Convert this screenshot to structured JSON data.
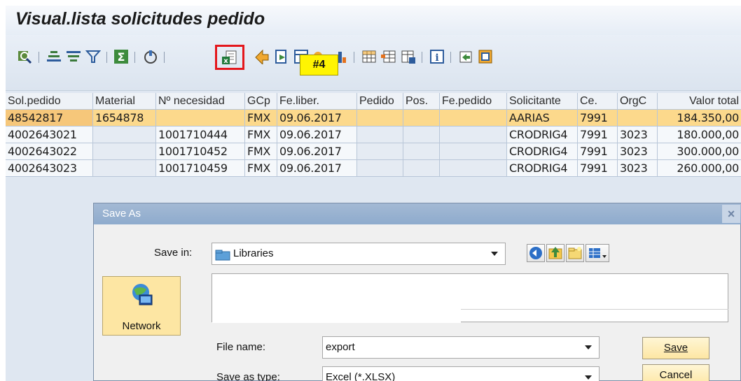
{
  "window": {
    "title": "Visual.lista solicitudes pedido"
  },
  "tooltip": {
    "text": "#4"
  },
  "toolbar": {
    "icons": [
      "details-icon",
      "sort-ascending-icon",
      "sort-descending-icon",
      "filter-icon",
      "sum-icon",
      "subtotal-icon",
      "export-spreadsheet-icon",
      "print-preview-icon",
      "local-file-icon",
      "change-layout-icon",
      "abc-analysis-icon",
      "graphic-icon",
      "grid-layout-icon",
      "select-layout-icon",
      "save-layout-icon",
      "info-icon",
      "mail-icon",
      "settings-icon"
    ]
  },
  "table": {
    "columns": [
      "Sol.pedido",
      "Material",
      "Nº necesidad",
      "GCp",
      "Fe.liber.",
      "Pedido",
      "Pos.",
      "Fe.pedido",
      "Solicitante",
      "Ce.",
      "OrgC",
      "Valor total"
    ],
    "rows": [
      [
        "48542817",
        "1654878",
        "",
        "FMX",
        "09.06.2017",
        "",
        "",
        "",
        "AARIAS",
        "7991",
        "",
        "184.350,00"
      ],
      [
        "4002643021",
        "",
        "1001710444",
        "FMX",
        "09.06.2017",
        "",
        "",
        "",
        "CRODRIG4",
        "7991",
        "3023",
        "180.000,00"
      ],
      [
        "4002643022",
        "",
        "1001710452",
        "FMX",
        "09.06.2017",
        "",
        "",
        "",
        "CRODRIG4",
        "7991",
        "3023",
        "300.000,00"
      ],
      [
        "4002643023",
        "",
        "1001710459",
        "FMX",
        "09.06.2017",
        "",
        "",
        "",
        "CRODRIG4",
        "7991",
        "3023",
        "260.000,00"
      ]
    ]
  },
  "dialog": {
    "title": "Save As",
    "save_in_label": "Save in:",
    "save_in_value": "Libraries",
    "places_label": "Network",
    "file_name_label": "File name:",
    "file_name_value": "export",
    "save_type_label": "Save as type:",
    "save_type_value": "Excel (*.XLSX)",
    "save_button": "Save",
    "cancel_button": "Cancel"
  },
  "colors": {
    "selected_row": "#fcd98c",
    "highlight": "#e4171c",
    "tooltip_bg": "#fff402"
  }
}
